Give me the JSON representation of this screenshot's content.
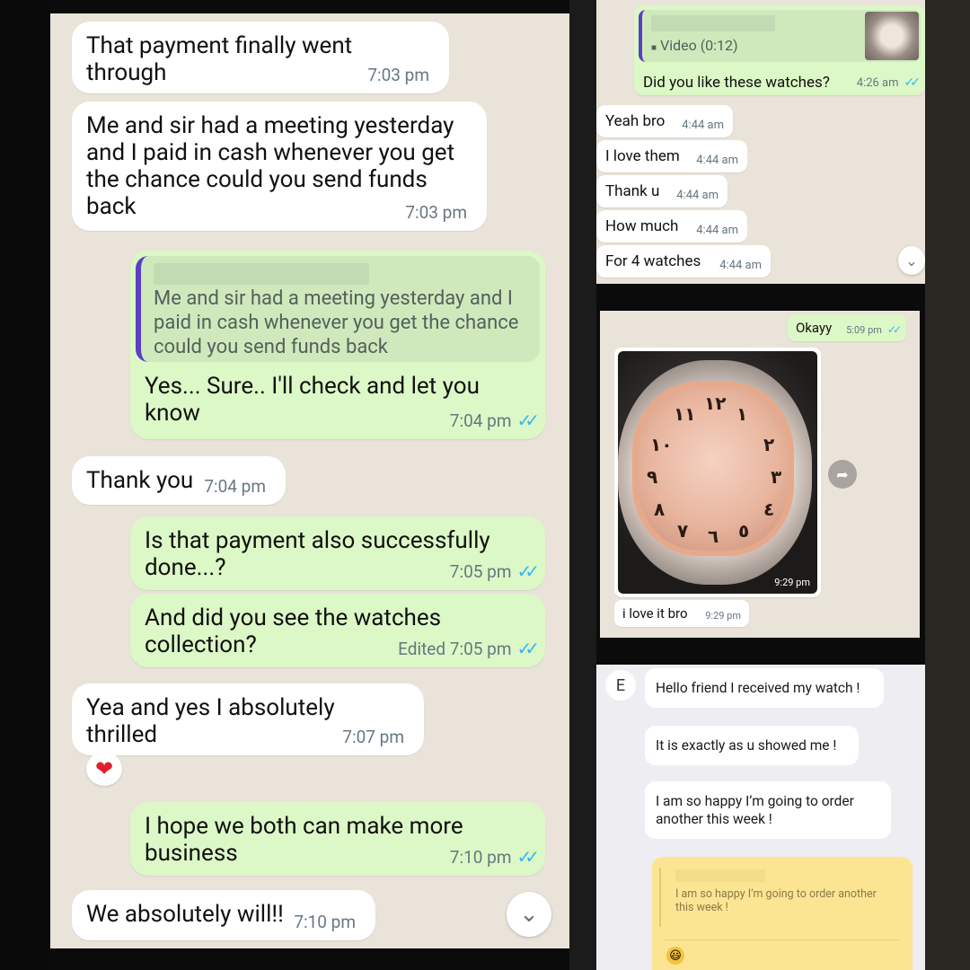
{
  "panel_a": {
    "messages": [
      {
        "text": "That payment finally went through",
        "time": "7:03 pm"
      },
      {
        "text": "Me and sir had a meeting yesterday and I paid in cash whenever you get the chance could you send funds back",
        "time": "7:03 pm"
      },
      {
        "quote": "Me and sir had a meeting yesterday and I paid in cash whenever you get the chance could you send funds back",
        "text": "Yes... Sure.. I'll check and let you know",
        "time": "7:04 pm"
      },
      {
        "text": "Thank you",
        "time": "7:04 pm"
      },
      {
        "text": "Is that payment also successfully done...?",
        "time": "7:05 pm"
      },
      {
        "text": "And did you see the watches collection?",
        "time": "Edited  7:05 pm"
      },
      {
        "text": "Yea and yes I absolutely thrilled",
        "time": "7:07 pm"
      },
      {
        "text": "I hope we both can make more business",
        "time": "7:10 pm"
      },
      {
        "text": "We absolutely will!!",
        "time": "7:10 pm"
      }
    ],
    "reaction": "❤",
    "ticks": "✓✓",
    "scroll_icon": "⌄"
  },
  "panel_b": {
    "video_label": "Video (0:12)",
    "video_icon": "■",
    "messages": [
      {
        "text": "Did you like these watches?",
        "time": "4:26 am"
      },
      {
        "text": "Yeah bro",
        "time": "4:44 am"
      },
      {
        "text": "I love them",
        "time": "4:44 am"
      },
      {
        "text": "Thank u",
        "time": "4:44 am"
      },
      {
        "text": "How much",
        "time": "4:44 am"
      },
      {
        "text": "For 4 watches",
        "time": "4:44 am"
      }
    ]
  },
  "panel_c": {
    "messages": [
      {
        "text": "Okayy",
        "time": "5:09 pm"
      },
      {
        "text": "i love it bro",
        "time": "9:29 pm"
      }
    ],
    "photo_time": "9:29 pm",
    "forward_icon": "➦"
  },
  "panel_d": {
    "avatar_letter": "E",
    "messages": [
      {
        "text": "Hello friend I received my watch !"
      },
      {
        "text": "It is exactly as u showed me !"
      },
      {
        "text": "I am so happy I’m going to order another this week !"
      }
    ],
    "quote": "I am so happy I’m going to order another this week !",
    "reply_emoji": "😃"
  }
}
